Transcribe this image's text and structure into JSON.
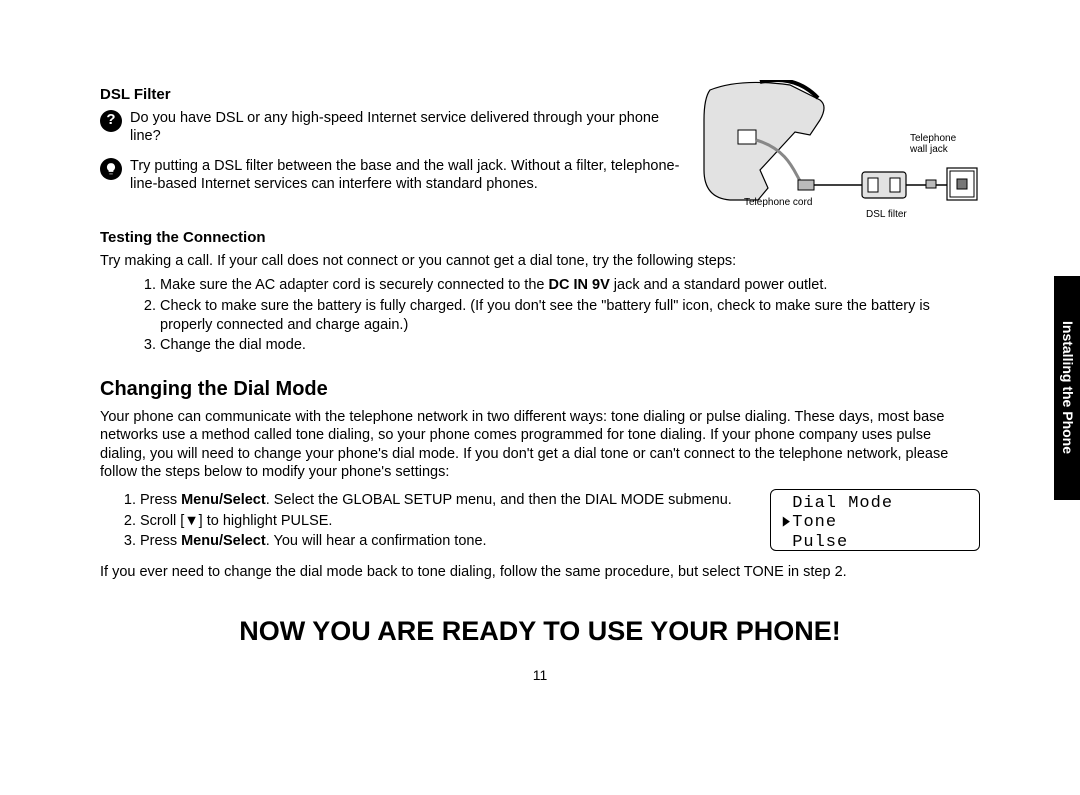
{
  "side_tab": "Installing the Phone",
  "dsl": {
    "heading": "DSL Filter",
    "q_text": "Do you have DSL or any high-speed Internet service delivered through your phone line?",
    "tip_text": "Try putting a DSL filter between the base and the wall jack. Without a filter, telephone-line-based Internet services can interfere with standard phones.",
    "diagram_labels": {
      "wall_jack": "Telephone\nwall jack",
      "cord": "Telephone cord",
      "dsl_filter": "DSL filter"
    }
  },
  "testing": {
    "heading": "Testing the Connection",
    "intro": "Try making a call. If your call does not connect or you cannot get a dial tone, try the following steps:",
    "steps": [
      {
        "pre": "Make sure the AC adapter cord is securely connected to the ",
        "bold": "DC IN 9V",
        "post": " jack and a standard power outlet."
      },
      {
        "pre": "Check to make sure the battery is fully charged. (If you don't see the \"battery full\" icon, check to make sure the battery is properly connected and charge again.)",
        "bold": "",
        "post": ""
      },
      {
        "pre": "Change the dial mode.",
        "bold": "",
        "post": ""
      }
    ]
  },
  "dialmode": {
    "heading": "Changing the Dial Mode",
    "intro": "Your phone can communicate with the telephone network in two different ways: tone dialing or pulse dialing. These days, most base networks use a method called tone dialing, so your phone comes programmed for tone dialing. If your phone company uses pulse dialing, you will need to change your phone's dial mode. If you don't get a dial tone or can't connect to the telephone network, please follow the steps below to modify your phone's settings:",
    "steps": {
      "s1_a": "Press ",
      "s1_b": "Menu/Select",
      "s1_c": ". Select the GLOBAL SETUP menu, and then the DIAL MODE submenu.",
      "s2": "Scroll [▼] to highlight PULSE.",
      "s3_a": "Press ",
      "s3_b": "Menu/Select",
      "s3_c": ". You will hear a confirmation tone."
    },
    "after": "If you ever need to change the dial mode back to tone dialing, follow the same procedure, but select TONE in step 2.",
    "lcd": {
      "line1": "Dial Mode",
      "line2": "Tone",
      "line3": "Pulse"
    }
  },
  "ready": "NOW YOU ARE READY TO USE YOUR PHONE!",
  "page_number": "11"
}
